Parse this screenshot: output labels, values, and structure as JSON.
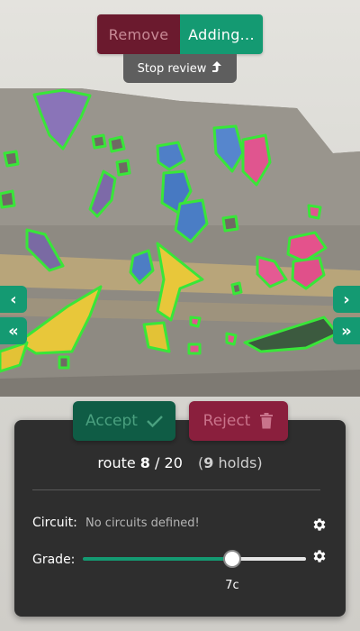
{
  "mode": {
    "remove_label": "Remove",
    "adding_label": "Adding...",
    "stop_review_label": "Stop review",
    "stop_review_icon": "arrow-up-icon"
  },
  "navigation": {
    "prev_icon": "chevron-left-icon",
    "first_icon": "double-chevron-left-icon",
    "next_icon": "chevron-right-icon",
    "last_icon": "double-chevron-right-icon"
  },
  "actions": {
    "accept_label": "Accept",
    "accept_icon": "check-icon",
    "reject_label": "Reject",
    "reject_icon": "trash-icon"
  },
  "route": {
    "prefix": "route",
    "current": "8",
    "separator": "/",
    "total": "20",
    "holds_count": "9",
    "holds_suffix": "holds"
  },
  "circuit": {
    "label": "Circuit:",
    "value": "No circuits defined!"
  },
  "grade": {
    "label": "Grade:",
    "value": "7c",
    "slider_fraction": 0.67
  },
  "colors": {
    "accent": "#149a72",
    "remove": "#6b1a2e",
    "reject": "#8a1f3d",
    "panel": "#2e2e2e",
    "hold_highlight": "#39e639"
  }
}
